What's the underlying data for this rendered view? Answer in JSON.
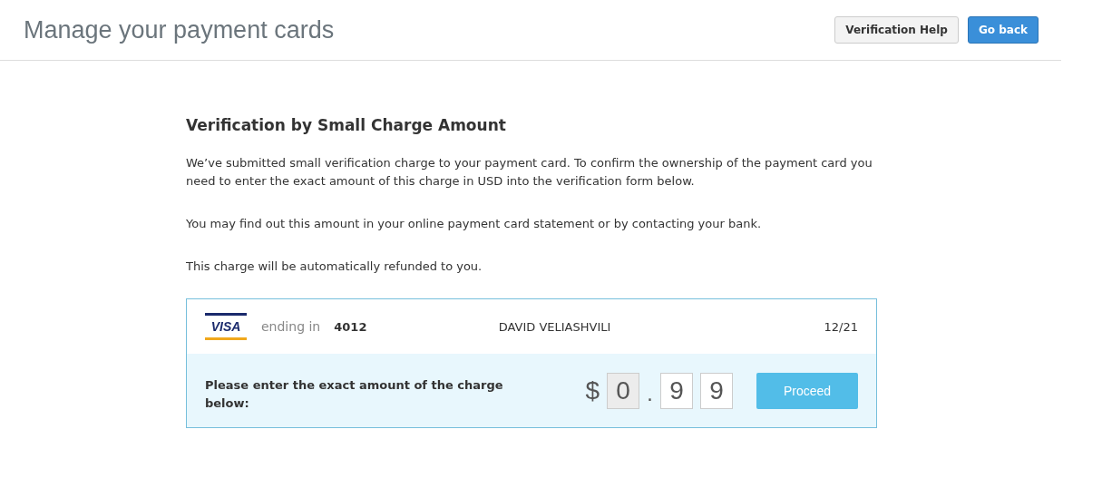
{
  "header": {
    "title": "Manage your payment cards",
    "buttons": [
      {
        "label": "Verification Help",
        "kind": "secondary"
      },
      {
        "label": "Go back",
        "kind": "primary"
      }
    ]
  },
  "section": {
    "heading": "Verification by Small Charge Amount",
    "paragraphs": [
      "We’ve submitted small verification charge to your payment card. To confirm the ownership of the payment card you need to enter the exact amount of this charge in USD into the verification form below.",
      "You may find out this amount in your online payment card statement or by contacting your bank.",
      "This charge will be automatically refunded to you."
    ]
  },
  "card": {
    "brand": "VISA",
    "ending_label": "ending in",
    "last4": "4012",
    "holder": "DAVID VELIASHVILI",
    "expiry": "12/21"
  },
  "form": {
    "prompt": "Please enter the exact amount of the charge below:",
    "currency": "$",
    "separator": ".",
    "digits": [
      {
        "value": "0",
        "disabled": true
      },
      {
        "value": "9",
        "disabled": false
      },
      {
        "value": "9",
        "disabled": false
      }
    ],
    "submit": "Proceed"
  }
}
